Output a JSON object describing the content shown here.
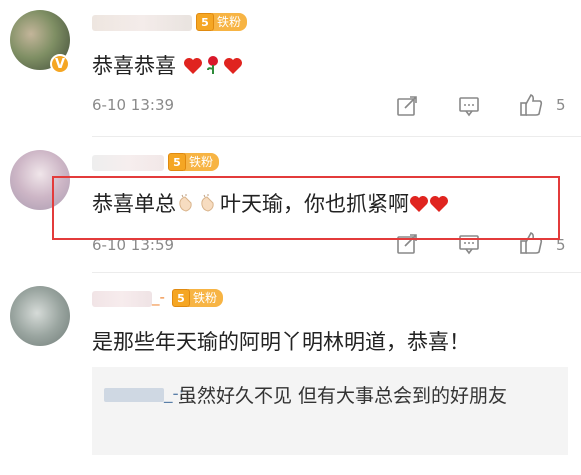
{
  "comments": [
    {
      "text": "恭喜恭喜",
      "time": "6-10 13:39",
      "likes": "5",
      "fan_label": "铁粉",
      "fan_level": "5",
      "verified_mark": "V",
      "avatar_color": "#8a9a6e"
    },
    {
      "text_a": "恭喜单总",
      "text_b": "叶天瑜，你也抓紧啊",
      "time": "6-10 13:59",
      "likes": "5",
      "fan_label": "铁粉",
      "fan_level": "5",
      "avatar_color": "#c9b8c9"
    },
    {
      "name_suffix": "_-",
      "text": "是那些年天瑜的阿明丫明林明道，恭喜！",
      "fan_label": "铁粉",
      "fan_level": "5",
      "avatar_color": "#9aa5a0",
      "reply": {
        "name_suffix": "_-:",
        "text": "虽然好久不见 但有大事总会到的好朋友"
      }
    }
  ],
  "colors": {
    "highlight_border": "#e33b3b",
    "heart": "#e0241f",
    "fan_badge": "#f5a623"
  },
  "icons": [
    "verified-icon",
    "heart-emoji",
    "rose-emoji",
    "clap-emoji",
    "share-icon",
    "comment-icon",
    "like-icon"
  ]
}
